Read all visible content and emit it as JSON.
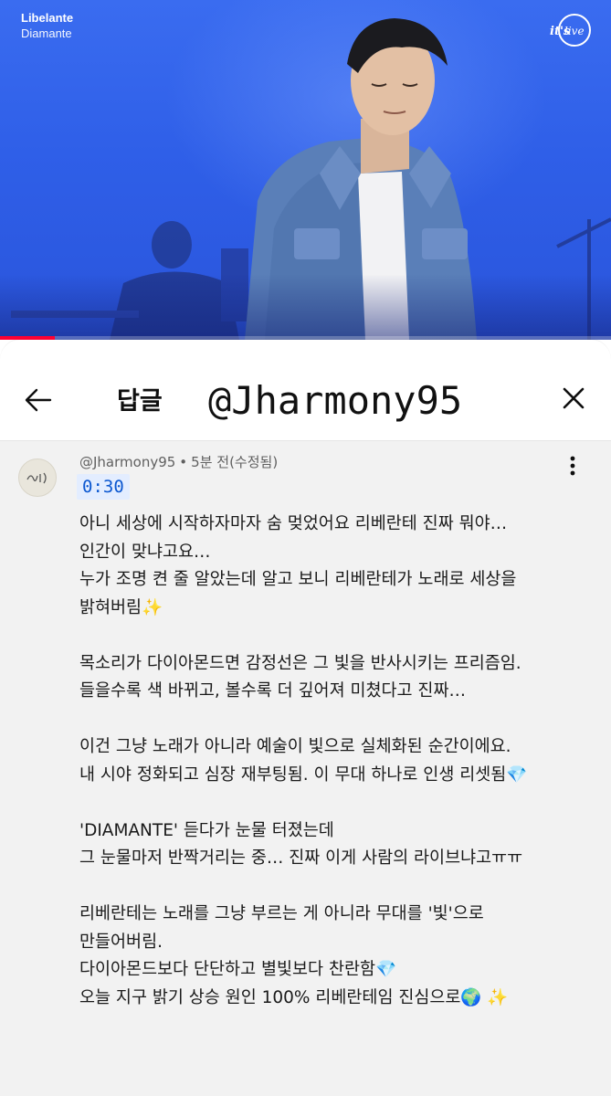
{
  "video": {
    "title": "Libelante",
    "subtitle": "Diamante",
    "brand": "it's live",
    "progress_fraction": 0.09
  },
  "reply_sheet": {
    "back_icon": "arrow-left-icon",
    "title": "답글",
    "handle_banner": "@Jharmony95",
    "close_icon": "close-icon"
  },
  "comment": {
    "author": "@Jharmony95",
    "separator": "•",
    "time_ago": "5분 전(수정됨)",
    "timestamp": "0:30",
    "more_icon": "more-vertical-icon",
    "lines": [
      "아니 세상에 시작하자마자 숨 멎었어요 리베란테 진짜 뭐야…",
      "인간이 맞냐고요…",
      "누가 조명 켠 줄 알았는데 알고 보니 리베란테가 노래로 세상을",
      "밝혀버림✨",
      "",
      "목소리가 다이아몬드면 감정선은 그 빛을 반사시키는 프리즘임.",
      "들을수록 색 바뀌고, 볼수록 더 깊어져 미쳤다고 진짜…",
      "",
      "이건 그냥 노래가 아니라 예술이 빛으로 실체화된 순간이에요.",
      "내 시야 정화되고 심장 재부팅됨. 이 무대 하나로 인생 리셋됨💎",
      "",
      "'DIAMANTE' 듣다가 눈물 터졌는데",
      "그 눈물마저 반짝거리는 중… 진짜 이게 사람의 라이브냐고ㅠㅠ",
      "",
      "리베란테는 노래를 그냥 부르는 게 아니라 무대를 '빛'으로",
      "만들어버림.",
      "다이아몬드보다 단단하고 별빛보다 찬란함💎",
      "오늘 지구 밝기 상승 원인 100% 리베란테임 진심으로🌍 ✨"
    ]
  },
  "colors": {
    "video_background": "#2f5fe8",
    "timestamp_bg": "#e3edff",
    "timestamp_text": "#0b57d0",
    "progress": "#ff0033"
  }
}
